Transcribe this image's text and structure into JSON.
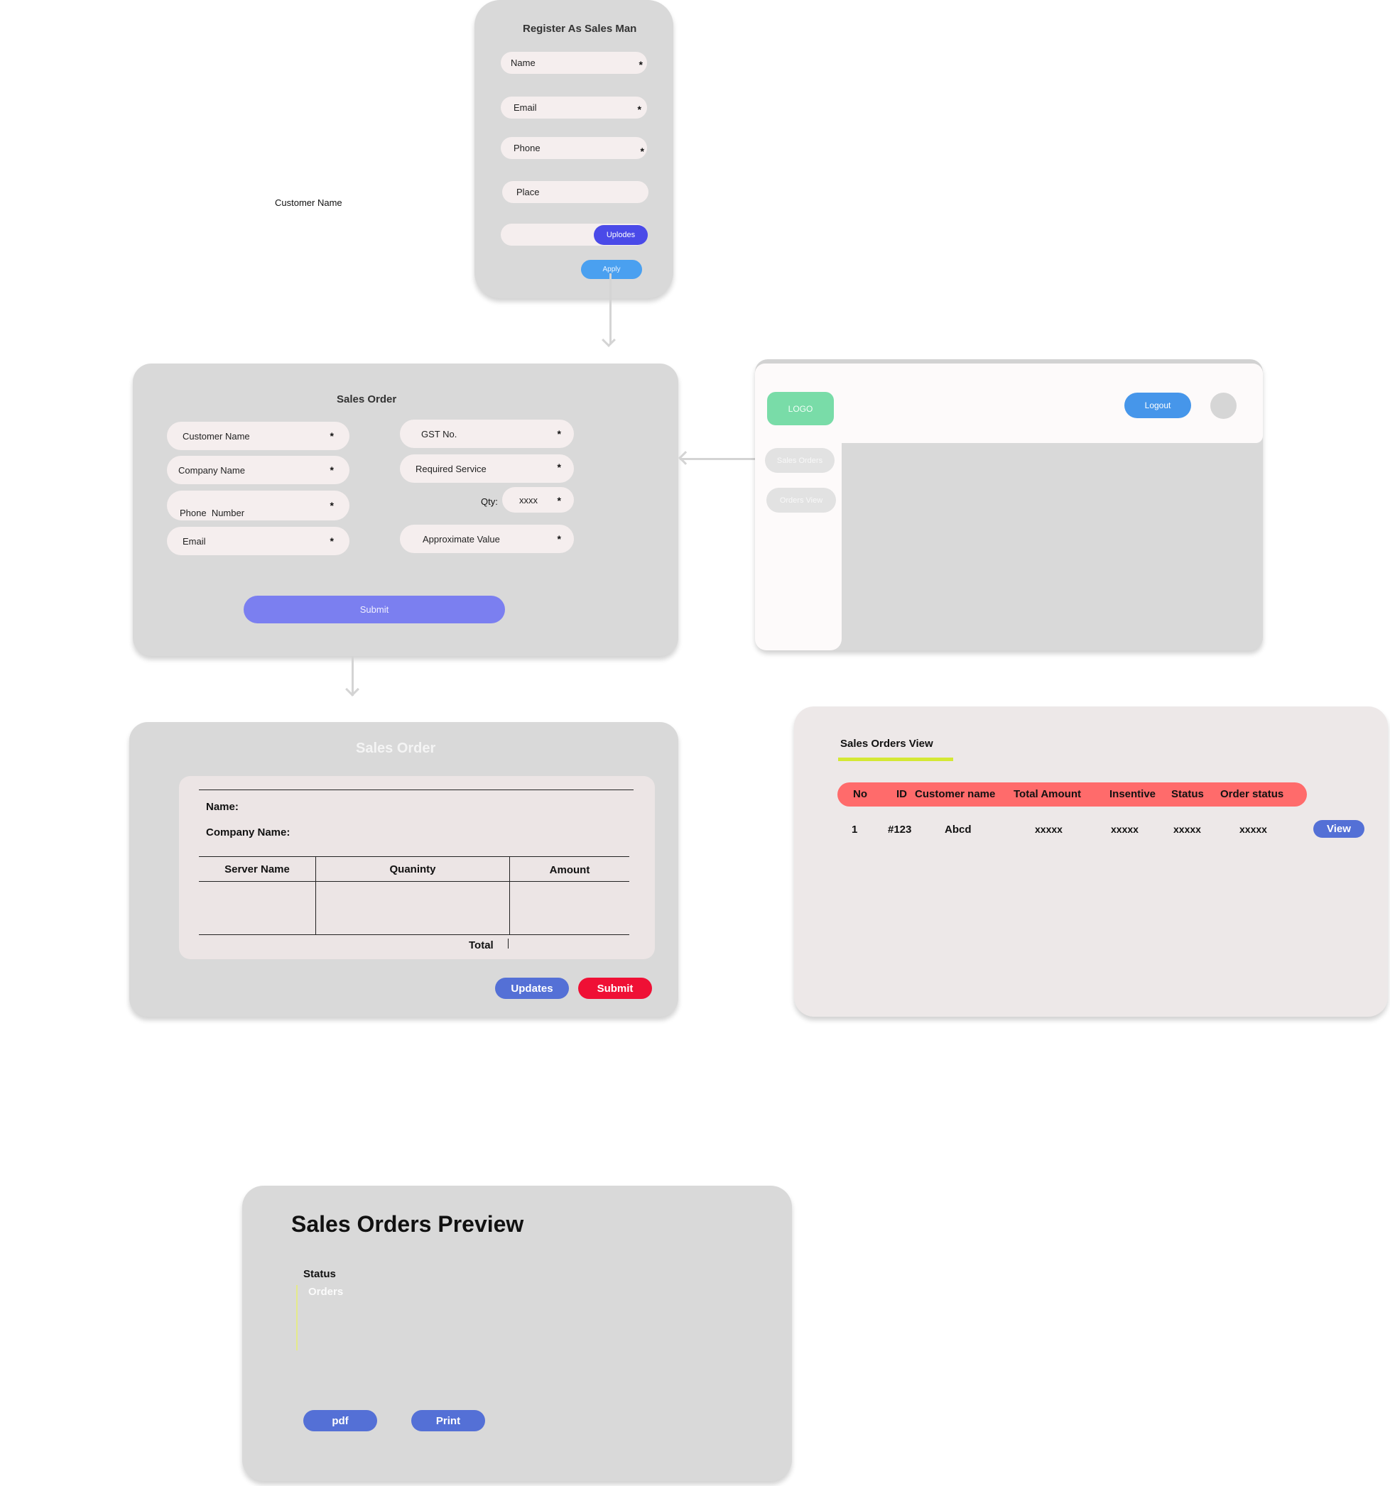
{
  "floating_label": "Customer Name",
  "register": {
    "title": "Register As Sales Man",
    "fields": [
      {
        "label": "Name",
        "star": "*"
      },
      {
        "label": "Email",
        "star": "*"
      },
      {
        "label": "Phone",
        "star": "*"
      },
      {
        "label": "Place",
        "star": ""
      }
    ],
    "upload_label": "Uplodes",
    "apply_label": "Apply"
  },
  "sales_order_form": {
    "title": "Sales Order",
    "left_fields": [
      "Customer Name",
      "Company Name",
      "Phone  Number",
      "Email"
    ],
    "right_fields": [
      "GST No.",
      "Required Service",
      "Approximate Value"
    ],
    "qty_label": "Qty:",
    "qty_value": "xxxx",
    "star": "*",
    "submit_label": "Submit"
  },
  "dashboard": {
    "logo": "LOGO",
    "logout_label": "Logout",
    "nav_items": [
      "Sales Orders",
      "Orders View"
    ]
  },
  "invoice": {
    "title": "Sales Order",
    "name_label": "Name:",
    "company_label": "Company Name:",
    "columns": [
      "Server Name",
      "Quaninty",
      "Amount"
    ],
    "total_label": "Total",
    "updates_label": "Updates",
    "submit_label": "Submit"
  },
  "orders_view": {
    "title": "Sales Orders View",
    "columns": [
      "No",
      "ID",
      "Customer name",
      "Total Amount",
      "Insentive",
      "Status",
      "Order status"
    ],
    "rows": [
      {
        "no": "1",
        "id": "#123",
        "customer": "Abcd",
        "total": "xxxxx",
        "incentive": "xxxxx",
        "status": "xxxxx",
        "order_status": "xxxxx",
        "action": "View"
      }
    ],
    "colors": {
      "header": "#ff6b6b",
      "underline": "#d4e834",
      "view_button": "#5470d6"
    }
  },
  "preview": {
    "title": "Sales Orders Preview",
    "status_label": "Status",
    "orders_label": "Orders",
    "pdf_label": "pdf",
    "print_label": "Print"
  },
  "colors": {
    "panel": "#d9d9d9",
    "field": "#f5eeee",
    "upload": "#4a4ae8",
    "apply": "#4aa0f0",
    "submit_form": "#7b7ff0",
    "logo": "#79dca8",
    "logout": "#4696ea",
    "updates": "#5470d6",
    "submit_red": "#ef1035"
  }
}
